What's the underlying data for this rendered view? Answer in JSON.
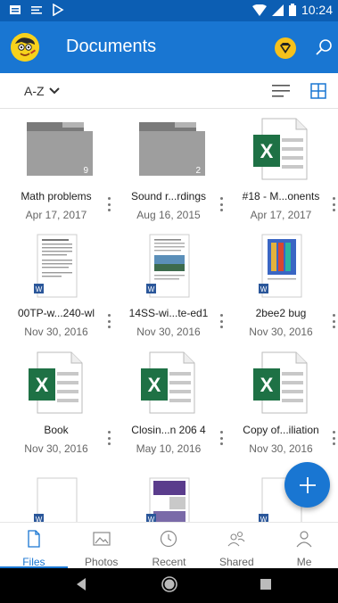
{
  "status_bar": {
    "time": "10:24"
  },
  "app_bar": {
    "title": "Documents"
  },
  "toolbar": {
    "sort_label": "A-Z"
  },
  "items": [
    {
      "name": "Math problems",
      "date": "Apr 17, 2017",
      "type": "folder",
      "count": "9"
    },
    {
      "name": "Sound r...rdings",
      "date": "Aug 16, 2015",
      "type": "folder",
      "count": "2"
    },
    {
      "name": "#18 - M...onents",
      "date": "Apr 17, 2017",
      "type": "excel"
    },
    {
      "name": "00TP-w...240-wl",
      "date": "Nov 30, 2016",
      "type": "word-doc"
    },
    {
      "name": "14SS-wi...te-ed1",
      "date": "Nov 30, 2016",
      "type": "word-doc-image"
    },
    {
      "name": "2bee2 bug",
      "date": "Nov 30, 2016",
      "type": "word-doc-colorful"
    },
    {
      "name": "Book",
      "date": "Nov 30, 2016",
      "type": "excel"
    },
    {
      "name": "Closin...n 206 4",
      "date": "May 10, 2016",
      "type": "excel"
    },
    {
      "name": "Copy of...iliation",
      "date": "Nov 30, 2016",
      "type": "excel"
    }
  ],
  "bottom_nav": [
    {
      "label": "Files",
      "icon": "file-icon",
      "active": true
    },
    {
      "label": "Photos",
      "icon": "photo-icon",
      "active": false
    },
    {
      "label": "Recent",
      "icon": "clock-icon",
      "active": false
    },
    {
      "label": "Shared",
      "icon": "people-icon",
      "active": false
    },
    {
      "label": "Me",
      "icon": "person-icon",
      "active": false
    }
  ],
  "colors": {
    "primary": "#1976d2",
    "status_bar": "#0c5eb3",
    "excel_green": "#1e7145",
    "folder_gray": "#9e9e9e"
  }
}
